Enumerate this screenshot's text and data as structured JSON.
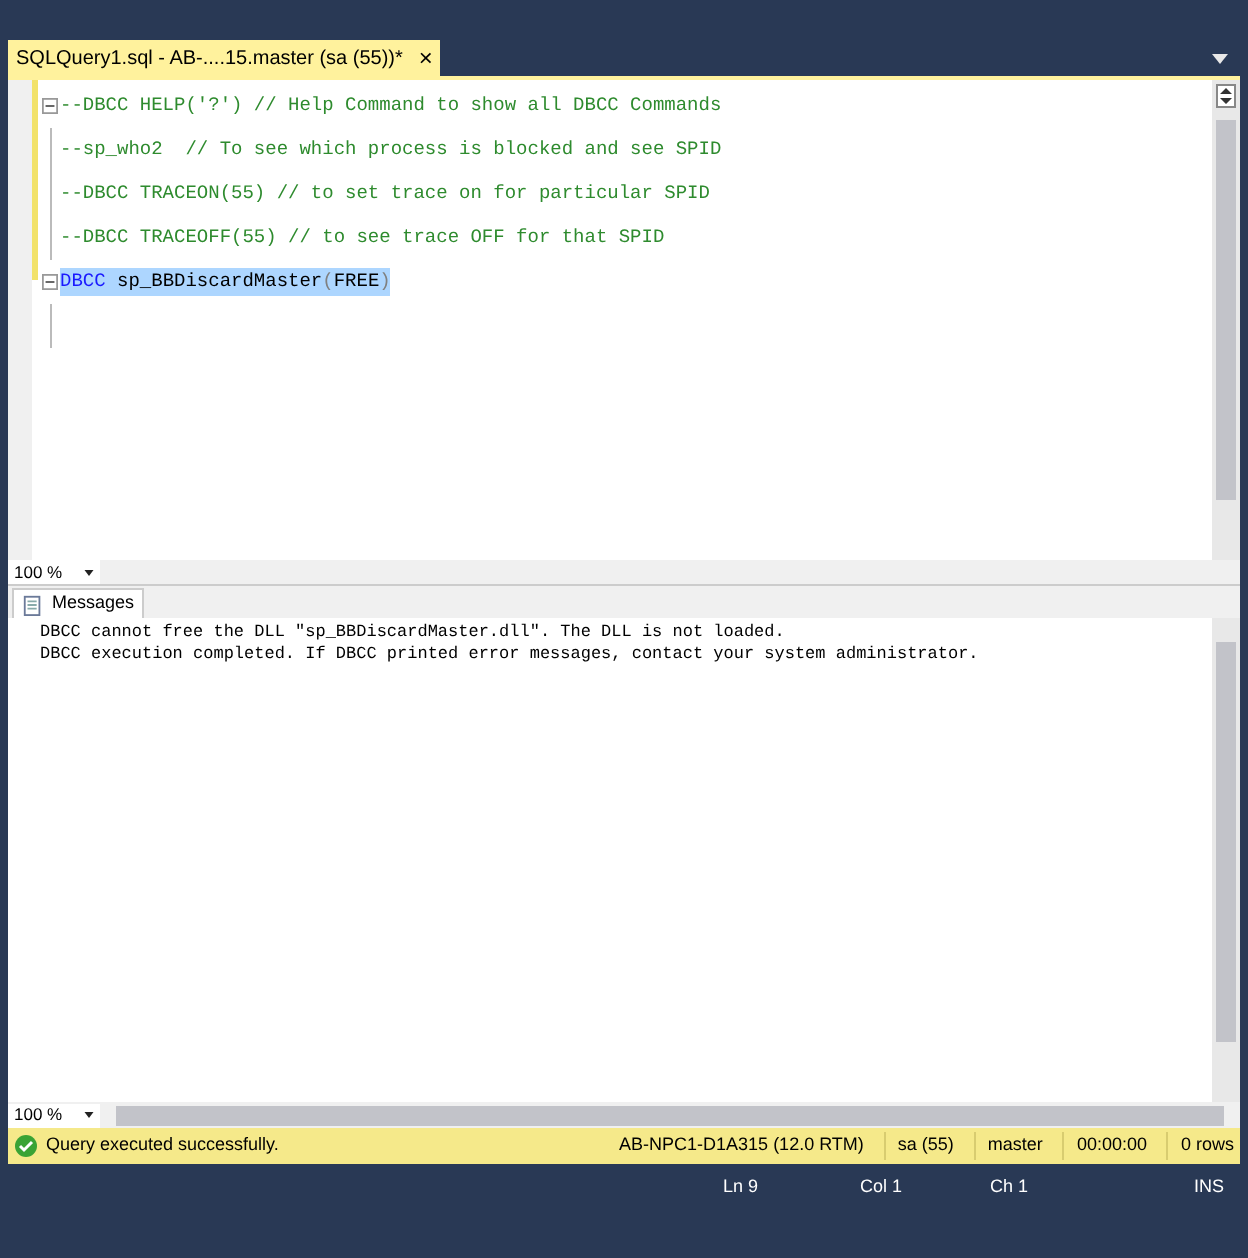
{
  "tab": {
    "title": "SQLQuery1.sql - AB-....15.master (sa (55))*",
    "close": "×",
    "selected": true
  },
  "editor": {
    "lines": [
      {
        "fold": true,
        "selected": false,
        "tokens": [
          {
            "kind": "comment",
            "text": "--DBCC HELP('?') // Help Command to show all DBCC Commands"
          }
        ]
      },
      {
        "fold": false,
        "selected": false,
        "tokens": [
          {
            "kind": "comment",
            "text": "--sp_who2  // To see which process is blocked and see SPID"
          }
        ]
      },
      {
        "fold": false,
        "selected": false,
        "tokens": [
          {
            "kind": "comment",
            "text": "--DBCC TRACEON(55) // to set trace on for particular SPID"
          }
        ]
      },
      {
        "fold": false,
        "selected": false,
        "tokens": [
          {
            "kind": "comment",
            "text": "--DBCC TRACEOFF(55) // to see trace OFF for that SPID"
          }
        ]
      },
      {
        "fold": true,
        "selected": true,
        "tokens": [
          {
            "kind": "keyword",
            "text": "DBCC"
          },
          {
            "kind": "plain",
            "text": " sp_BBDiscardMaster"
          },
          {
            "kind": "punct",
            "text": "("
          },
          {
            "kind": "plain",
            "text": "FREE"
          },
          {
            "kind": "punct",
            "text": ")"
          }
        ]
      }
    ],
    "zoom": "100 %"
  },
  "results": {
    "tab": "Messages",
    "messages": [
      "DBCC cannot free the DLL \"sp_BBDiscardMaster.dll\". The DLL is not loaded.",
      "DBCC execution completed. If DBCC printed error messages, contact your system administrator."
    ],
    "zoom": "100 %"
  },
  "query_status": {
    "message": "Query executed successfully.",
    "fields": [
      "AB-NPC1-D1A315 (12.0 RTM)",
      "sa (55)",
      "master",
      "00:00:00",
      "0 rows"
    ]
  },
  "status_bar": [
    "Ln 9",
    "Col 1",
    "Ch 1",
    "INS"
  ]
}
